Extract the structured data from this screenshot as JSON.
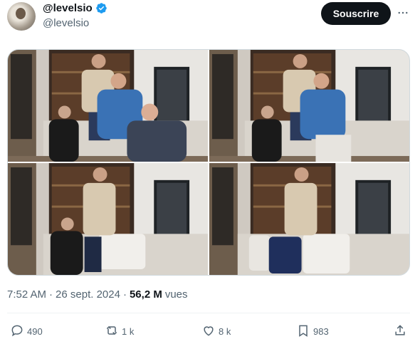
{
  "author": {
    "display_name": "@levelsio",
    "handle": "@levelsio",
    "verified_icon": "verified-badge-icon"
  },
  "follow_button": {
    "label": "Souscrire"
  },
  "more_menu": {
    "icon": "more-horizontal-icon"
  },
  "media": {
    "photos": [
      {
        "alt": "photo-1"
      },
      {
        "alt": "photo-2"
      },
      {
        "alt": "photo-3"
      },
      {
        "alt": "photo-4"
      }
    ]
  },
  "meta": {
    "time": "7:52 AM",
    "separator1": "·",
    "date": "26 sept. 2024",
    "separator2": "·",
    "views_count": "56,2 M",
    "views_label": "vues"
  },
  "actions": {
    "reply": {
      "icon": "reply-icon",
      "count": "490"
    },
    "repost": {
      "icon": "repost-icon",
      "count": "1 k"
    },
    "like": {
      "icon": "heart-icon",
      "count": "8 k"
    },
    "bookmark": {
      "icon": "bookmark-icon",
      "count": "983"
    },
    "share": {
      "icon": "share-icon"
    }
  },
  "colors": {
    "text_primary": "#0f1419",
    "text_secondary": "#536471",
    "verified_blue": "#1d9bf0"
  }
}
